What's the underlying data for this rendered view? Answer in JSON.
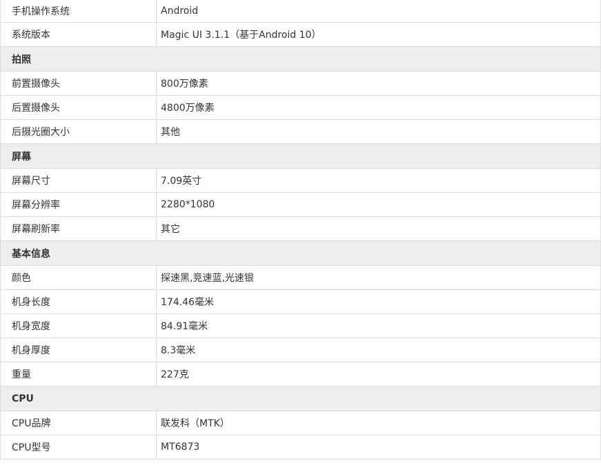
{
  "spec": {
    "os": {
      "label": "手机操作系统",
      "value": "Android"
    },
    "version": {
      "label": "系统版本",
      "value": "Magic UI 3.1.1（基于Android 10）"
    },
    "camera": {
      "title": "拍照",
      "rows": [
        {
          "label": "前置摄像头",
          "value": "800万像素"
        },
        {
          "label": "后置摄像头",
          "value": "4800万像素"
        },
        {
          "label": "后摄光圈大小",
          "value": "其他"
        }
      ]
    },
    "screen": {
      "title": "屏幕",
      "rows": [
        {
          "label": "屏幕尺寸",
          "value": "7.09英寸"
        },
        {
          "label": "屏幕分辨率",
          "value": "2280*1080"
        },
        {
          "label": "屏幕刷新率",
          "value": "其它"
        }
      ]
    },
    "basic": {
      "title": "基本信息",
      "rows": [
        {
          "label": "颜色",
          "value": "探速黑,竞速蓝,光速银"
        },
        {
          "label": "机身长度",
          "value": "174.46毫米"
        },
        {
          "label": "机身宽度",
          "value": "84.91毫米"
        },
        {
          "label": "机身厚度",
          "value": "8.3毫米"
        },
        {
          "label": "重量",
          "value": "227克"
        }
      ]
    },
    "cpu": {
      "title": "CPU",
      "rows": [
        {
          "label": "CPU品牌",
          "value": "联发科（MTK）"
        },
        {
          "label": "CPU型号",
          "value": "MT6873"
        }
      ]
    }
  }
}
